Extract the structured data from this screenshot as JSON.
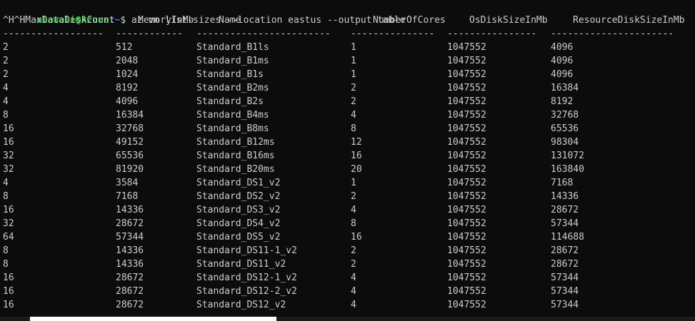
{
  "prompt": {
    "user": "olawale@Azure",
    "path": ":~",
    "symbol": "$",
    "command": " az vm list-sizes --location eastus --output table"
  },
  "table": {
    "headers": [
      "^H^HMaxDataDiskCount",
      "MemoryInMb",
      "Name",
      "NumberOfCores",
      "OsDiskSizeInMb",
      "ResourceDiskSizeInMb"
    ],
    "separators": [
      "------------------",
      "------------",
      "------------------------",
      "---------------",
      "----------------",
      "----------------------"
    ],
    "rows": [
      [
        "2",
        "512",
        "Standard_B1ls",
        "1",
        "1047552",
        "4096"
      ],
      [
        "2",
        "2048",
        "Standard_B1ms",
        "1",
        "1047552",
        "4096"
      ],
      [
        "2",
        "1024",
        "Standard_B1s",
        "1",
        "1047552",
        "4096"
      ],
      [
        "4",
        "8192",
        "Standard_B2ms",
        "2",
        "1047552",
        "16384"
      ],
      [
        "4",
        "4096",
        "Standard_B2s",
        "2",
        "1047552",
        "8192"
      ],
      [
        "8",
        "16384",
        "Standard_B4ms",
        "4",
        "1047552",
        "32768"
      ],
      [
        "16",
        "32768",
        "Standard_B8ms",
        "8",
        "1047552",
        "65536"
      ],
      [
        "16",
        "49152",
        "Standard_B12ms",
        "12",
        "1047552",
        "98304"
      ],
      [
        "32",
        "65536",
        "Standard_B16ms",
        "16",
        "1047552",
        "131072"
      ],
      [
        "32",
        "81920",
        "Standard_B20ms",
        "20",
        "1047552",
        "163840"
      ],
      [
        "4",
        "3584",
        "Standard_DS1_v2",
        "1",
        "1047552",
        "7168"
      ],
      [
        "8",
        "7168",
        "Standard_DS2_v2",
        "2",
        "1047552",
        "14336"
      ],
      [
        "16",
        "14336",
        "Standard_DS3_v2",
        "4",
        "1047552",
        "28672"
      ],
      [
        "32",
        "28672",
        "Standard_DS4_v2",
        "8",
        "1047552",
        "57344"
      ],
      [
        "64",
        "57344",
        "Standard_DS5_v2",
        "16",
        "1047552",
        "114688"
      ],
      [
        "8",
        "14336",
        "Standard_DS11-1_v2",
        "2",
        "1047552",
        "28672"
      ],
      [
        "8",
        "14336",
        "Standard_DS11_v2",
        "2",
        "1047552",
        "28672"
      ],
      [
        "16",
        "28672",
        "Standard_DS12-1_v2",
        "4",
        "1047552",
        "57344"
      ],
      [
        "16",
        "28672",
        "Standard_DS12-2_v2",
        "4",
        "1047552",
        "57344"
      ],
      [
        "16",
        "28672",
        "Standard_DS12_v2",
        "4",
        "1047552",
        "57344"
      ]
    ]
  },
  "colors": {
    "background": "#0c0c0c",
    "text": "#cccccc",
    "prompt_user": "#13c22e",
    "prompt_path": "#3b78ff"
  }
}
